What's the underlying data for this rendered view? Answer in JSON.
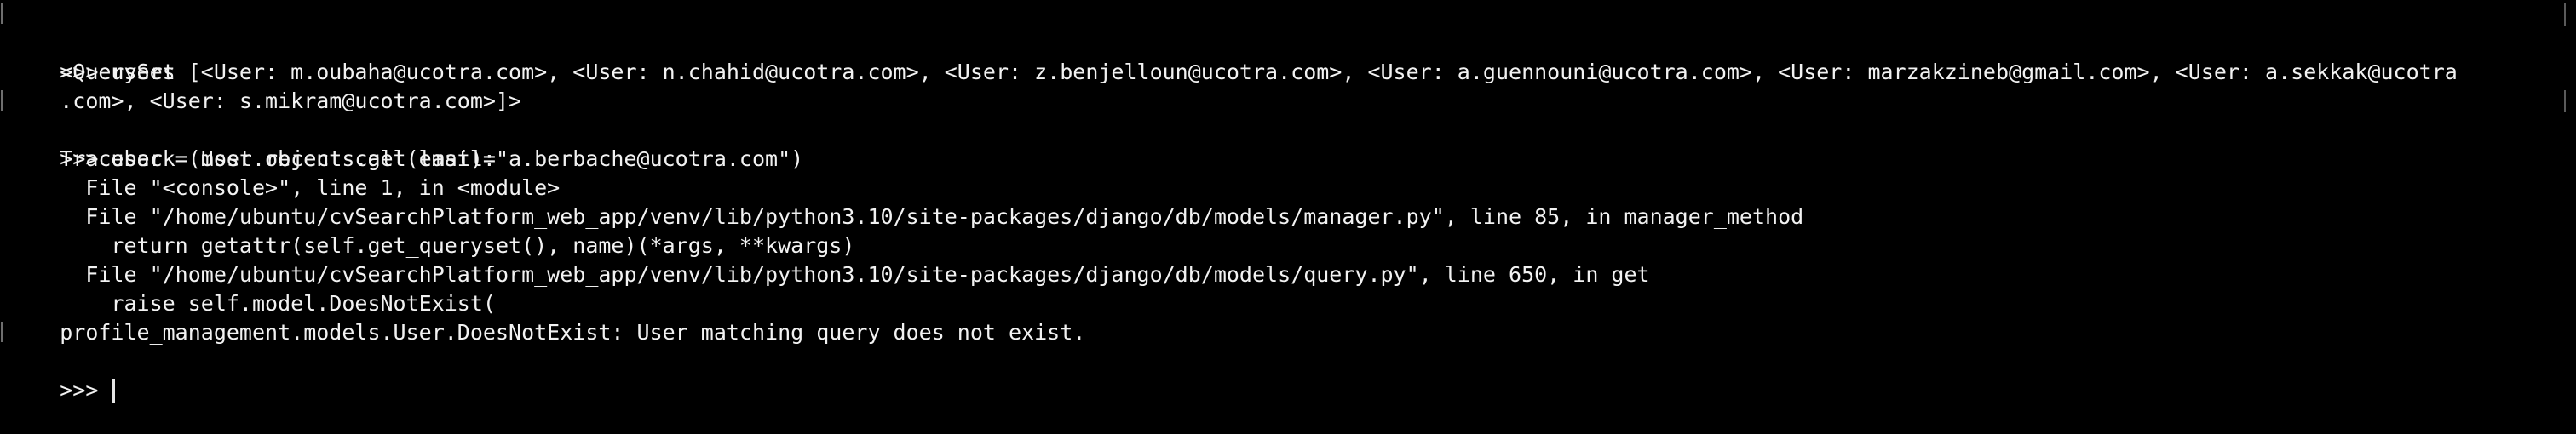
{
  "terminal": {
    "lines": [
      ">>> users",
      "<QuerySet [<User: m.oubaha@ucotra.com>, <User: n.chahid@ucotra.com>, <User: z.benjelloun@ucotra.com>, <User: a.guennouni@ucotra.com>, <User: marzakzineb@gmail.com>, <User: a.sekkak@ucotra",
      ".com>, <User: s.mikram@ucotra.com>]>",
      ">>> user = User.objects.get(email=\"a.berbache@ucotra.com\")",
      "Traceback (most recent call last):",
      "  File \"<console>\", line 1, in <module>",
      "  File \"/home/ubuntu/cvSearchPlatform_web_app/venv/lib/python3.10/site-packages/django/db/models/manager.py\", line 85, in manager_method",
      "    return getattr(self.get_queryset(), name)(*args, **kwargs)",
      "  File \"/home/ubuntu/cvSearchPlatform_web_app/venv/lib/python3.10/site-packages/django/db/models/query.py\", line 650, in get",
      "    raise self.model.DoesNotExist(",
      "profile_management.models.User.DoesNotExist: User matching query does not exist.",
      ">>> "
    ]
  }
}
